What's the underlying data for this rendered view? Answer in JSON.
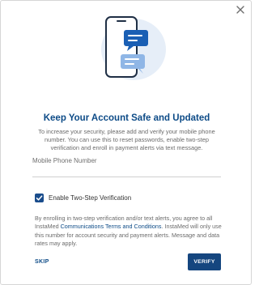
{
  "dialog": {
    "title": "Keep Your Account Safe and Updated",
    "description": "To increase your security, please add and verify your mobile phone number. You can use this to reset passwords, enable two-step verification and enroll in payment alerts via text message.",
    "phone_field": {
      "placeholder": "Mobile Phone Number",
      "value": ""
    },
    "two_step": {
      "label": "Enable Two-Step Verification",
      "checked": true
    },
    "legal": {
      "before": "By enrolling in two-step verification and/or text alerts, you agree to all InstaMed ",
      "link": "Communications Terms and Conditions",
      "after": ". InstaMed will only use this number for account security and payment alerts. Message and data rates may apply."
    },
    "skip_label": "SKIP",
    "verify_label": "VERIFY"
  },
  "colors": {
    "primary": "#15467f",
    "title": "#0d4b87",
    "illustration_blob": "#e6eef8",
    "bubble_front": "#1a5fb4",
    "bubble_back": "#8fb6e6"
  },
  "icons": {
    "close": "close-icon",
    "illustration": "phone-chat-illustration",
    "check": "check-icon"
  }
}
